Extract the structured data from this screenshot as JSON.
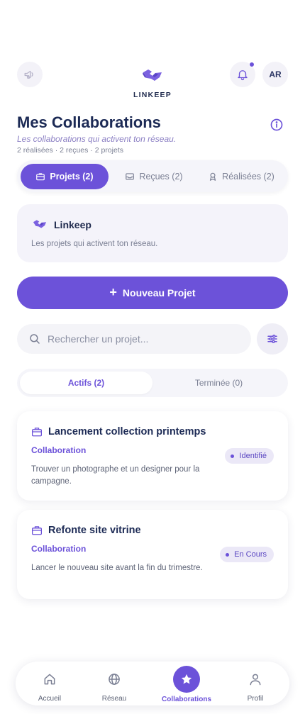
{
  "header": {
    "brand_name": "LINKEEP",
    "avatar_initials": "AR",
    "has_notification": true
  },
  "page": {
    "title": "Mes Collaborations",
    "subtitle": "Les collaborations qui activent ton réseau.",
    "counts": "2 réalisées · 2 reçues · 2 projets"
  },
  "tabs": [
    {
      "label": "Projets (2)",
      "icon": "briefcase-icon",
      "active": true
    },
    {
      "label": "Reçues (2)",
      "icon": "inbox-icon",
      "active": false
    },
    {
      "label": "Réalisées (2)",
      "icon": "award-icon",
      "active": false
    }
  ],
  "brand_card": {
    "name": "Linkeep",
    "description": "Les projets qui activent ton réseau."
  },
  "new_project_button": {
    "label": "Nouveau Projet"
  },
  "search": {
    "placeholder": "Rechercher un projet...",
    "value": ""
  },
  "segments": [
    {
      "label": "Actifs (2)",
      "active": true
    },
    {
      "label": "Terminée (0)",
      "active": false
    }
  ],
  "projects": [
    {
      "title": "Lancement collection printemps",
      "type": "Collaboration",
      "description": "Trouver un photographe et un designer pour la campagne.",
      "status": "Identifié"
    },
    {
      "title": "Refonte site vitrine",
      "type": "Collaboration",
      "description": "Lancer le nouveau site avant la fin du trimestre.",
      "status": "En Cours"
    }
  ],
  "bottom_nav": [
    {
      "label": "Accueil",
      "icon": "home-icon",
      "active": false
    },
    {
      "label": "Réseau",
      "icon": "globe-icon",
      "active": false
    },
    {
      "label": "Collaborations",
      "icon": "star-icon",
      "active": true
    },
    {
      "label": "Profil",
      "icon": "user-icon",
      "active": false
    }
  ],
  "colors": {
    "accent": "#6c52d9",
    "title": "#1c2a55",
    "muted": "#7a7f93",
    "surface": "#f4f3fa"
  }
}
